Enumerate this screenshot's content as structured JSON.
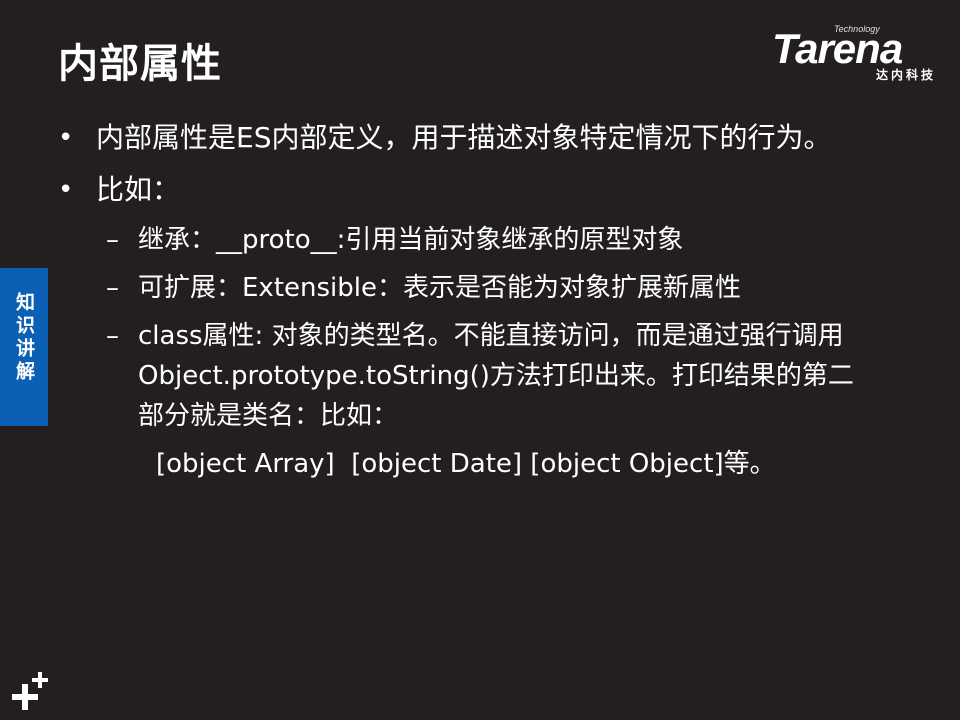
{
  "header": {
    "title": "内部属性",
    "logo": {
      "small": "Technology",
      "main": "Tarena",
      "sub": "达内科技"
    }
  },
  "side_tab": {
    "label": "知识讲解"
  },
  "content": {
    "bullets": [
      {
        "marker": "•",
        "text": "内部属性是ES内部定义，用于描述对象特定情况下的行为。"
      },
      {
        "marker": "•",
        "text": "比如："
      }
    ],
    "subitems": [
      {
        "marker": "–",
        "text": "继承：__proto__:引用当前对象继承的原型对象"
      },
      {
        "marker": "–",
        "text": "可扩展：Extensible：表示是否能为对象扩展新属性"
      },
      {
        "marker": "–",
        "text": "class属性: 对象的类型名。不能直接访问，而是通过强行调用Object.prototype.toString()方法打印出来。打印结果的第二部分就是类名：比如："
      }
    ],
    "example": "[object Array]  [object Date] [object Object]等。"
  },
  "icons": {
    "corner": "plus-icon"
  }
}
